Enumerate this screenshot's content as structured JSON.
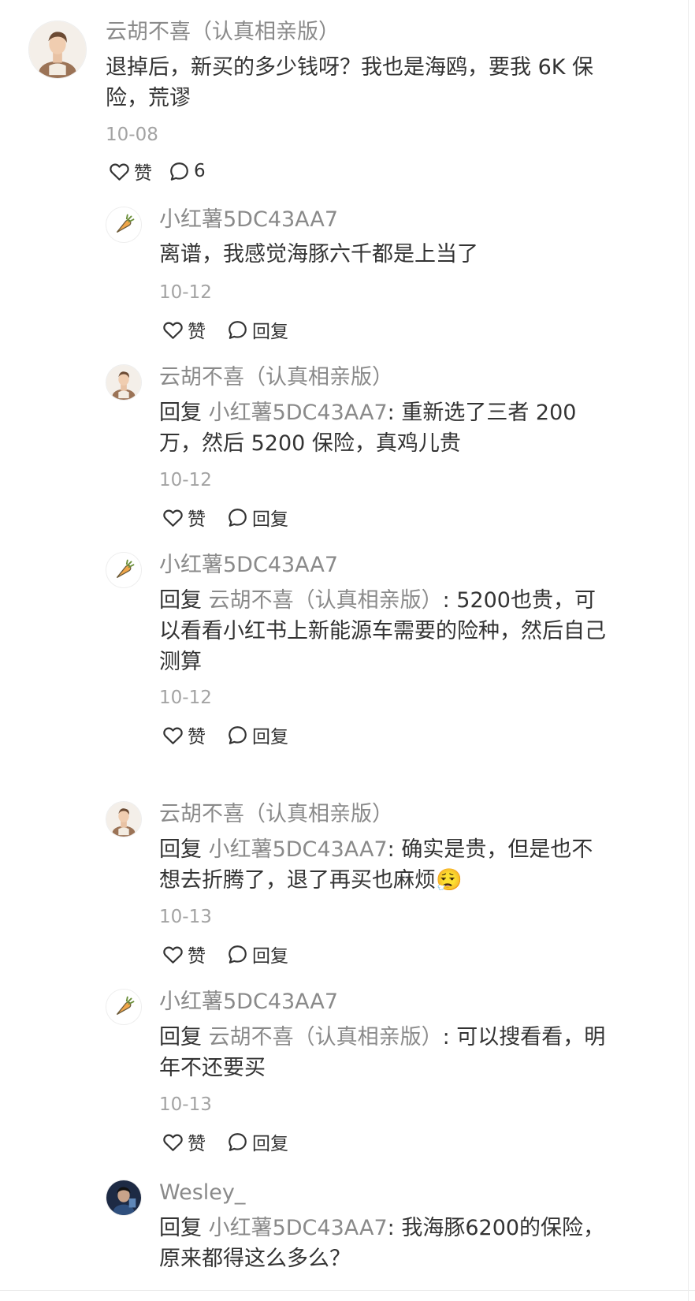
{
  "top_comment": {
    "author": "云胡不喜（认真相亲版）",
    "text": "退掉后，新买的多少钱呀？我也是海鸥，要我 6K 保险，荒谬",
    "date": "10-08",
    "like_label": "赞",
    "reply_count": "6"
  },
  "replies": [
    {
      "author": "小红薯5DC43AA7",
      "avatar": "carrot-icon",
      "reply_prefix": "",
      "reply_target": "",
      "text": "离谱，我感觉海豚六千都是上当了",
      "date": "10-12",
      "like_label": "赞",
      "reply_label": "回复"
    },
    {
      "author": "云胡不喜（认真相亲版）",
      "avatar": "person-avatar",
      "reply_prefix": "回复 ",
      "reply_target": "小红薯5DC43AA7",
      "text": ": 重新选了三者 200 万，然后 5200 保险，真鸡儿贵",
      "date": "10-12",
      "like_label": "赞",
      "reply_label": "回复"
    },
    {
      "author": "小红薯5DC43AA7",
      "avatar": "carrot-icon",
      "reply_prefix": "回复 ",
      "reply_target": "云胡不喜（认真相亲版）",
      "text": ": 5200也贵，可以看看小红书上新能源车需要的险种，然后自己测算",
      "date": "10-12",
      "like_label": "赞",
      "reply_label": "回复"
    },
    {
      "author": "云胡不喜（认真相亲版）",
      "avatar": "person-avatar",
      "reply_prefix": "回复 ",
      "reply_target": "小红薯5DC43AA7",
      "text": ": 确实是贵，但是也不想去折腾了，退了再买也麻烦😮‍💨",
      "date": "10-13",
      "like_label": "赞",
      "reply_label": "回复"
    },
    {
      "author": "小红薯5DC43AA7",
      "avatar": "carrot-icon",
      "reply_prefix": "回复 ",
      "reply_target": "云胡不喜（认真相亲版）",
      "text": ": 可以搜看看，明年不还要买",
      "date": "10-13",
      "like_label": "赞",
      "reply_label": "回复"
    },
    {
      "author": "Wesley_",
      "avatar": "photo-avatar",
      "reply_prefix": "回复 ",
      "reply_target": "小红薯5DC43AA7",
      "text": ": 我海豚6200的保险，原来都得这么多么？",
      "date": "",
      "like_label": "",
      "reply_label": ""
    }
  ]
}
